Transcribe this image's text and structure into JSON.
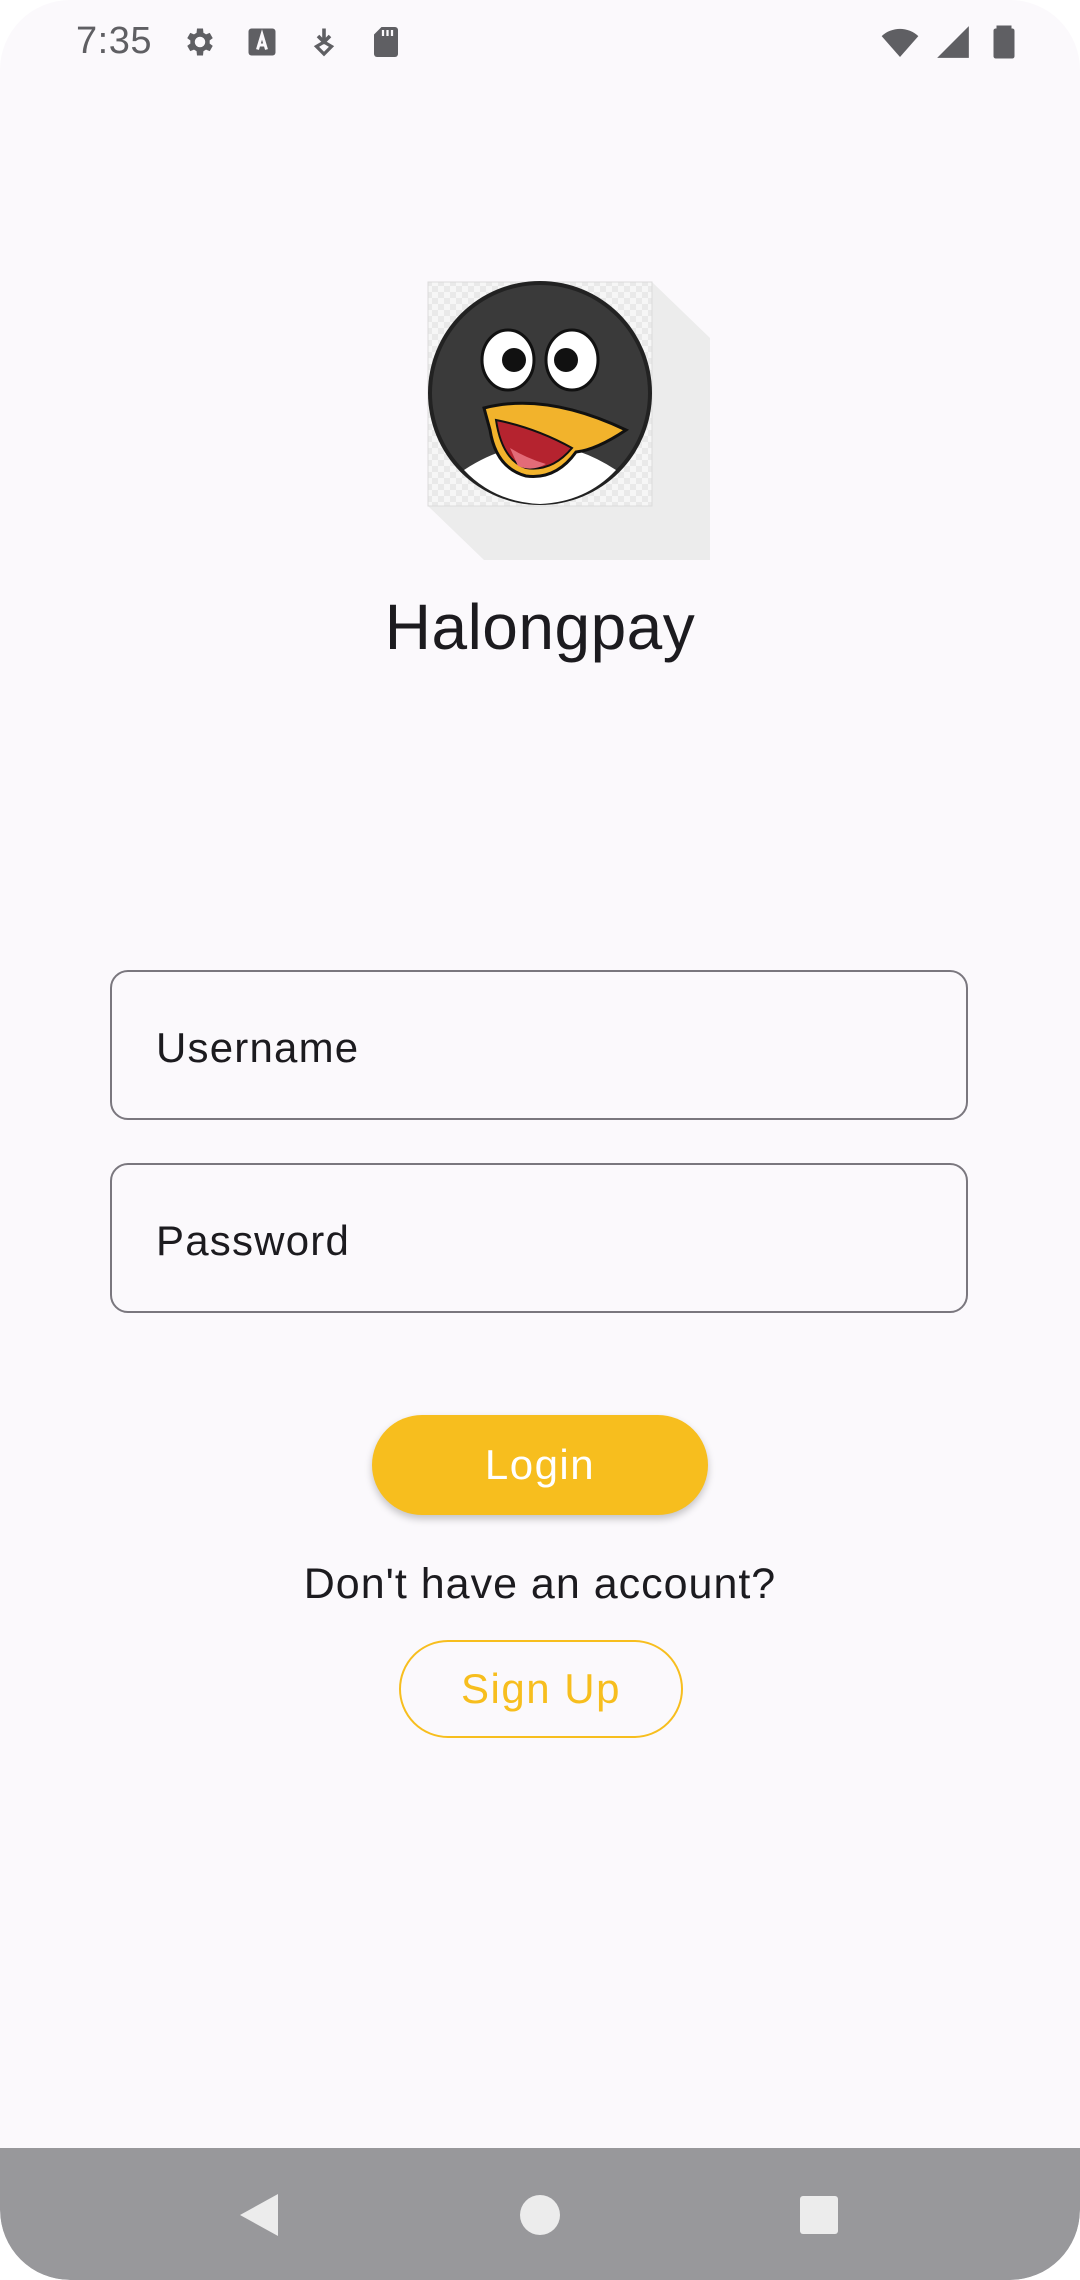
{
  "status_bar": {
    "time": "7:35",
    "left_icons": [
      "settings-icon",
      "text-a-icon",
      "download-badge-icon",
      "sd-card-icon"
    ],
    "right_icons": [
      "wifi-icon",
      "cell-signal-icon",
      "battery-icon"
    ]
  },
  "app": {
    "logo": "penguin-logo",
    "name": "Halongpay"
  },
  "form": {
    "username_placeholder": "Username",
    "password_placeholder": "Password",
    "login_label": "Login",
    "signup_prompt": "Don't have an account?",
    "signup_label": "Sign Up"
  },
  "colors": {
    "accent": "#f7be1e",
    "background": "#fbf9fc",
    "text": "#1c1b1f",
    "outline": "#7a777e",
    "nav_bar": "#98989b"
  },
  "nav_bar": {
    "buttons": [
      "back-icon",
      "home-icon",
      "recents-icon"
    ]
  }
}
